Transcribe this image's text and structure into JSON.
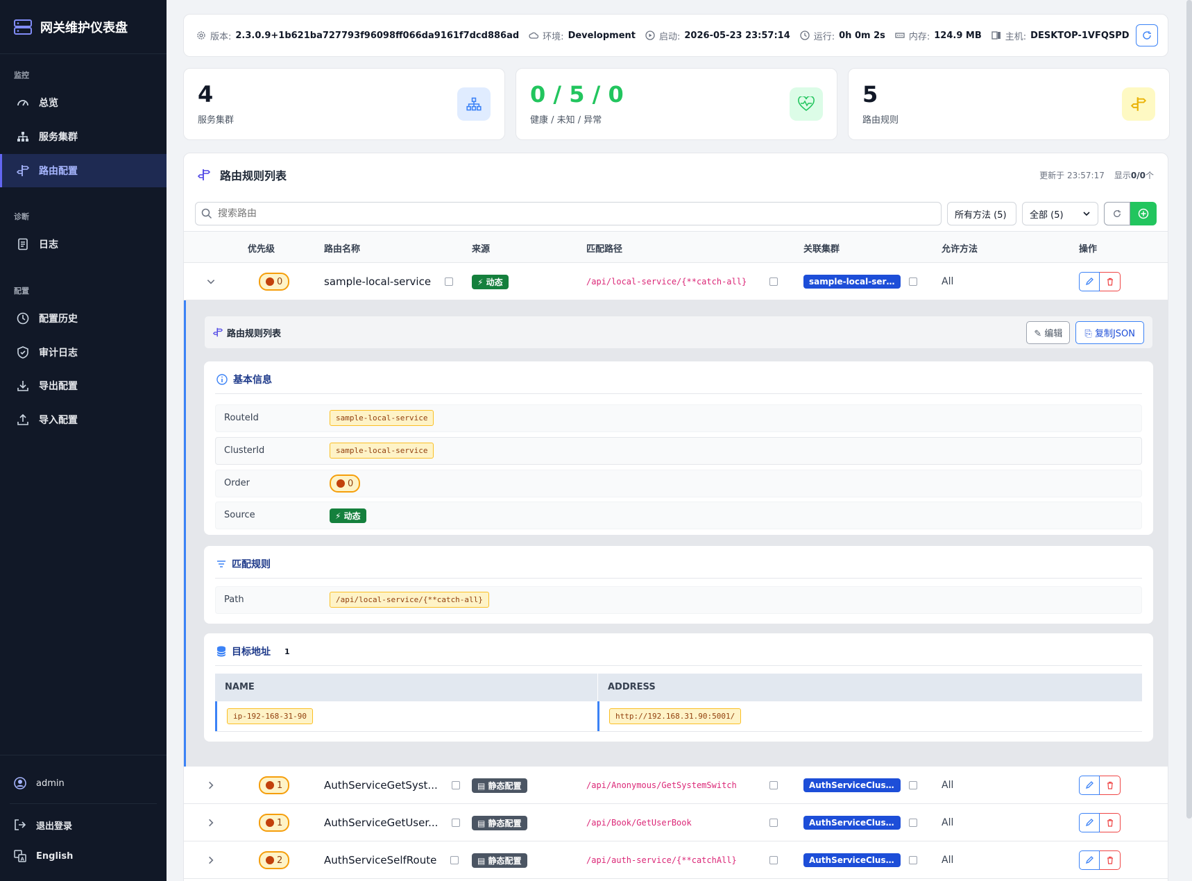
{
  "brand": {
    "title": "网关维护仪表盘",
    "icon": "server-stack-icon"
  },
  "nav": {
    "groups": {
      "monitor": "监控",
      "diagnose": "诊断",
      "config": "配置"
    },
    "items": [
      {
        "label": "总览",
        "icon": "gauge-icon"
      },
      {
        "label": "服务集群",
        "icon": "sitemap-icon"
      },
      {
        "label": "路由配置",
        "icon": "signpost-icon",
        "active": true
      },
      {
        "label": "日志",
        "icon": "journal-icon"
      },
      {
        "label": "配置历史",
        "icon": "clock-history-icon"
      },
      {
        "label": "审计日志",
        "icon": "shield-icon"
      },
      {
        "label": "导出配置",
        "icon": "download-icon"
      },
      {
        "label": "导入配置",
        "icon": "upload-icon"
      }
    ],
    "user": "admin",
    "logout": "退出登录",
    "language": "English"
  },
  "infobar": {
    "version_label": "版本:",
    "version": "2.3.0.9+1b621ba727793f96098ff066da9161f7dcd886ad",
    "env_label": "环境:",
    "env": "Development",
    "start_label": "启动:",
    "start": "2026-05-23 23:57:14",
    "uptime_label": "运行:",
    "uptime": "0h 0m 2s",
    "memory_label": "内存:",
    "memory": "124.9 MB",
    "host_label": "主机:",
    "host": "DESKTOP-1VFQSPD"
  },
  "stats": [
    {
      "value": "4",
      "label": "服务集群",
      "color": "#111827",
      "icon": "sitemap-icon"
    },
    {
      "value": "0 / 5 / 0",
      "label": "健康 / 未知 / 异常",
      "color": "#22c55e",
      "icon": "heart-pulse-icon"
    },
    {
      "value": "5",
      "label": "路由规则",
      "color": "#111827",
      "icon": "signpost-icon"
    }
  ],
  "panel": {
    "title": "路由规则列表",
    "updated": "更新于 23:57:17",
    "shown_prefix": "显示",
    "shown_count": "0/0",
    "shown_suffix": "个",
    "search_placeholder": "搜索路由",
    "method_filter": "所有方法 (5)",
    "scope_filter": "全部 (5)"
  },
  "table": {
    "headers": [
      "优先级",
      "路由名称",
      "来源",
      "匹配路径",
      "关联集群",
      "允许方法",
      "操作"
    ],
    "rows": [
      {
        "order": "0",
        "name": "sample-local-service",
        "source": "动态",
        "source_type": "dynamic",
        "path": "/api/local-service/{**catch-all}",
        "cluster": "sample-local-servi...",
        "methods": "All",
        "expanded": true
      },
      {
        "order": "1",
        "name": "AuthServiceGetSyst...",
        "source": "静态配置",
        "source_type": "static",
        "path": "/api/Anonymous/GetSystemSwitch",
        "cluster": "AuthServiceCluster",
        "methods": "All"
      },
      {
        "order": "1",
        "name": "AuthServiceGetUser...",
        "source": "静态配置",
        "source_type": "static",
        "path": "/api/Book/GetUserBook",
        "cluster": "AuthServiceCluster",
        "methods": "All"
      },
      {
        "order": "2",
        "name": "AuthServiceSelfRoute",
        "source": "静态配置",
        "source_type": "static",
        "path": "/api/auth-service/{**catchAll}",
        "cluster": "AuthServiceCluster",
        "methods": "All"
      }
    ]
  },
  "detail": {
    "title": "路由规则列表",
    "edit": "编辑",
    "copy_json": "复制JSON",
    "basic": {
      "title": "基本信息",
      "route_id_key": "RouteId",
      "route_id": "sample-local-service",
      "cluster_id_key": "ClusterId",
      "cluster_id": "sample-local-service",
      "order_key": "Order",
      "order": "0",
      "source_key": "Source",
      "source": "动态"
    },
    "match": {
      "title": "匹配规则",
      "path_key": "Path",
      "path": "/api/local-service/{**catch-all}"
    },
    "destinations": {
      "title": "目标地址",
      "count": "1",
      "name_header": "NAME",
      "address_header": "ADDRESS",
      "name": "ip-192-168-31-90",
      "address": "http://192.168.31.90:5001/"
    }
  }
}
